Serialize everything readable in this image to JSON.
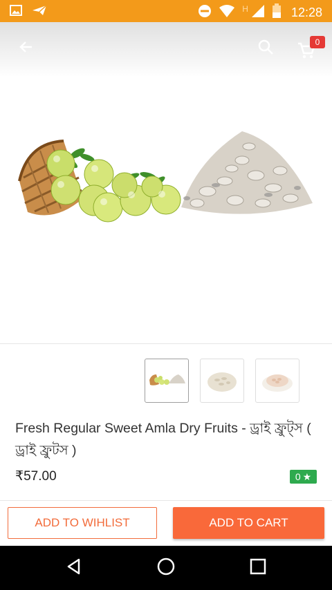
{
  "status_bar": {
    "time": "12:28",
    "network_letter": "H"
  },
  "toolbar": {
    "cart_count": "0"
  },
  "product": {
    "title": "Fresh Regular Sweet Amla Dry Fruits - ড্রাই ফ্রুট্স ( ড্রাই ফ্রুটস )",
    "price": "₹57.00",
    "rating": "0",
    "rating_star": "★"
  },
  "thumbnails": [
    {
      "name": "amla-and-dried-amla",
      "selected": true
    },
    {
      "name": "dried-amla-pile",
      "selected": false
    },
    {
      "name": "dried-amla-bowl",
      "selected": false
    }
  ],
  "actions": {
    "wishlist_label": "ADD TO WIHLIST",
    "cart_label": "ADD TO CART"
  },
  "colors": {
    "status_bar": "#f39a1a",
    "accent": "#f9693a",
    "rating_badge": "#2eaa4e",
    "cart_badge": "#e53935"
  },
  "icons": [
    "image-icon",
    "send-icon",
    "dnd-icon",
    "wifi-icon",
    "signal-icon",
    "battery-icon",
    "back-arrow-icon",
    "search-icon",
    "cart-icon",
    "nav-back-icon",
    "nav-home-icon",
    "nav-recents-icon"
  ]
}
